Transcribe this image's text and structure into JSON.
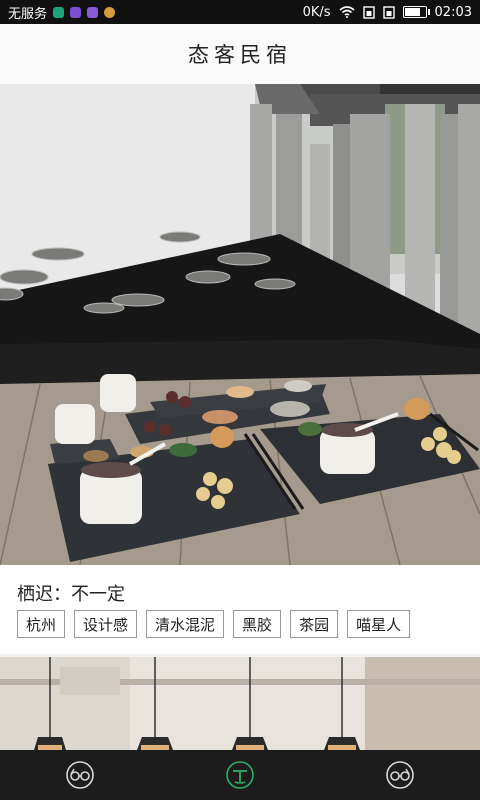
{
  "status_bar": {
    "carrier": "无服务",
    "speed": "0K/s",
    "time": "02:03",
    "battery_level": 0.85
  },
  "header": {
    "title": "态客民宿"
  },
  "listing": {
    "stay_text": "栖迟：不一定",
    "tags": [
      "杭州",
      "设计感",
      "清水混泥",
      "黑胶",
      "茶园",
      "喵星人"
    ]
  },
  "nav": {
    "items": [
      {
        "icon": "glasses-icon"
      },
      {
        "icon": "tea-icon",
        "active": true,
        "color": "#2fae68"
      },
      {
        "icon": "glasses-icon"
      }
    ]
  },
  "colors": {
    "accent": "#2fae68",
    "statusbar": "#111111",
    "navbar": "#1c1c1c"
  }
}
